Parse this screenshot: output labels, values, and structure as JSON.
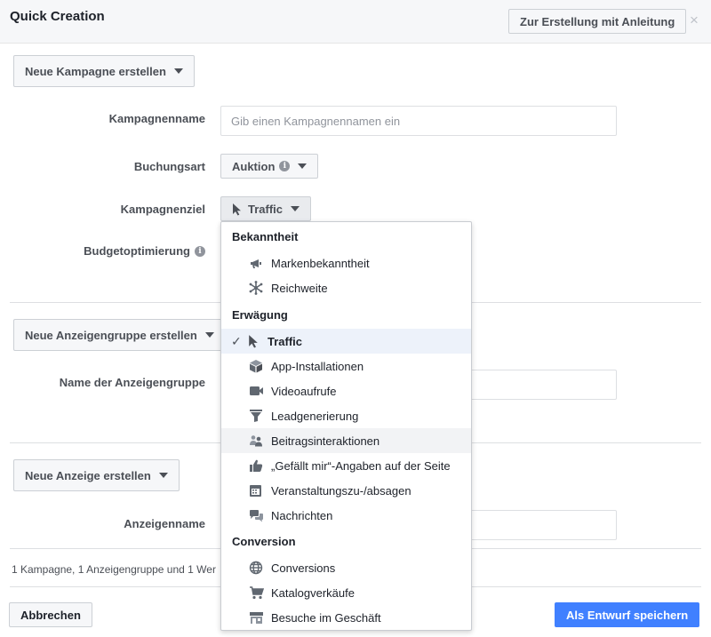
{
  "header": {
    "title": "Quick Creation",
    "guided_button": "Zur Erstellung mit Anleitung",
    "close": "×"
  },
  "campaign": {
    "section_button": "Neue Kampagne erstellen",
    "name_label": "Kampagnenname",
    "name_placeholder": "Gib einen Kampagnennamen ein",
    "buying_type_label": "Buchungsart",
    "buying_type_value": "Auktion",
    "objective_label": "Kampagnenziel",
    "objective_value": "Traffic",
    "budget_label": "Budgetoptimierung"
  },
  "adset": {
    "section_button": "Neue Anzeigengruppe erstellen",
    "name_label": "Name der Anzeigengruppe"
  },
  "ad": {
    "section_button": "Neue Anzeige erstellen",
    "name_label": "Anzeigenname"
  },
  "footer": {
    "summary": "1 Kampagne, 1 Anzeigengruppe und 1 Wer",
    "cancel": "Abbrechen",
    "save": "Als Entwurf speichern"
  },
  "objective_menu": {
    "check": "✓",
    "sections": [
      {
        "title": "Bekanntheit",
        "items": [
          {
            "label": "Markenbekanntheit",
            "icon": "megaphone-icon"
          },
          {
            "label": "Reichweite",
            "icon": "reach-icon"
          }
        ]
      },
      {
        "title": "Erwägung",
        "items": [
          {
            "label": "Traffic",
            "icon": "cursor-icon",
            "selected": true
          },
          {
            "label": "App-Installationen",
            "icon": "box-icon"
          },
          {
            "label": "Videoaufrufe",
            "icon": "video-camera-icon"
          },
          {
            "label": "Leadgenerierung",
            "icon": "funnel-icon"
          },
          {
            "label": "Beitragsinteraktionen",
            "icon": "people-icon",
            "hovered": true
          },
          {
            "label": "„Gefällt mir“-Angaben auf der Seite",
            "icon": "thumbs-up-icon"
          },
          {
            "label": "Veranstaltungszu-/absagen",
            "icon": "calendar-icon"
          },
          {
            "label": "Nachrichten",
            "icon": "chat-bubbles-icon"
          }
        ]
      },
      {
        "title": "Conversion",
        "items": [
          {
            "label": "Conversions",
            "icon": "globe-icon"
          },
          {
            "label": "Katalogverkäufe",
            "icon": "cart-icon"
          },
          {
            "label": "Besuche im Geschäft",
            "icon": "store-icon"
          }
        ]
      }
    ]
  }
}
